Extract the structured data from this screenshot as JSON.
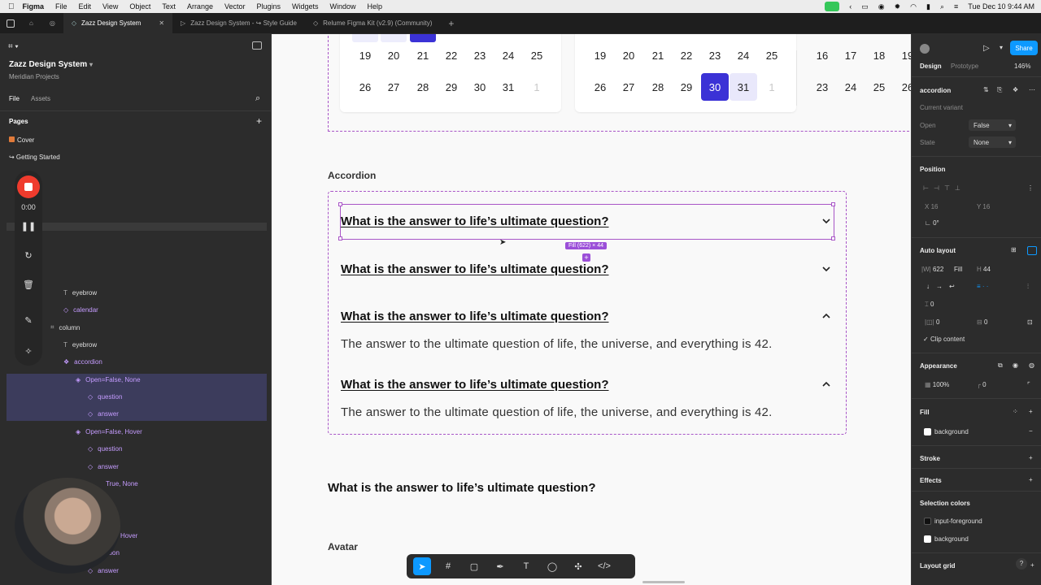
{
  "menubar": {
    "app": "Figma",
    "items": [
      "File",
      "Edit",
      "View",
      "Object",
      "Text",
      "Arrange",
      "Vector",
      "Plugins",
      "Widgets",
      "Window",
      "Help"
    ],
    "datetime": "Tue Dec 10  9:44 AM"
  },
  "tabs": [
    {
      "label": "Zazz Design System",
      "active": true
    },
    {
      "label": "Zazz Design System - ↪ Style Guide",
      "active": false
    },
    {
      "label": "Relume Figma Kit (v2.9) (Community)",
      "active": false
    }
  ],
  "left": {
    "file_name": "Zazz Design System",
    "project": "Meridian Projects",
    "tab_file": "File",
    "tab_assets": "Assets",
    "pages_heading": "Pages",
    "pages": [
      "Cover",
      "↪ Getting Started"
    ],
    "layers": [
      {
        "label": "eyebrow",
        "kind": "text"
      },
      {
        "label": "calendar",
        "kind": "comp"
      },
      {
        "label": "column",
        "kind": "frame"
      },
      {
        "label": "eyebrow",
        "kind": "text"
      },
      {
        "label": "accordion",
        "kind": "comp"
      },
      {
        "label": "Open=False, None",
        "kind": "comp"
      },
      {
        "label": "question",
        "kind": "comp"
      },
      {
        "label": "answer",
        "kind": "comp"
      },
      {
        "label": "Open=False, Hover",
        "kind": "comp"
      },
      {
        "label": "question",
        "kind": "comp"
      },
      {
        "label": "answer",
        "kind": "comp"
      },
      {
        "label": "True, None",
        "kind": "comp"
      },
      {
        "label": "Hover",
        "kind": "comp"
      },
      {
        "label": "stion",
        "kind": "comp"
      },
      {
        "label": "answer",
        "kind": "comp"
      }
    ]
  },
  "recorder": {
    "time": "0:00"
  },
  "canvas": {
    "calendar_rows_a": [
      [
        "19",
        "20",
        "21",
        "22",
        "23",
        "24",
        "25"
      ],
      [
        "26",
        "27",
        "28",
        "29",
        "30",
        "31",
        "1"
      ]
    ],
    "calendar_rows_b": [
      [
        "19",
        "20",
        "21",
        "22",
        "23",
        "24",
        "25"
      ],
      [
        "26",
        "27",
        "28",
        "29",
        "30",
        "31",
        "1"
      ]
    ],
    "calendar_rows_c": [
      [
        "16",
        "17",
        "18",
        "19"
      ],
      [
        "23",
        "24",
        "25",
        "26"
      ]
    ],
    "accordion_title": "Accordion",
    "question": "What is the answer to life’s ultimate question?",
    "answer": "The answer to the ultimate question of life, the universe, and everything is 42.",
    "fill_tag": "Fill (622) × 44",
    "standalone_question": "What is the answer to life’s ultimate question?",
    "avatar_title": "Avatar"
  },
  "right": {
    "tab_design": "Design",
    "tab_prototype": "Prototype",
    "zoom": "146%",
    "share": "Share",
    "component_name": "accordion",
    "current_variant": "Current variant",
    "prop_open_label": "Open",
    "prop_open_value": "False",
    "prop_state_label": "State",
    "prop_state_value": "None",
    "position": "Position",
    "x_value": "16",
    "y_value": "16",
    "rotation": "0°",
    "auto_layout": "Auto layout",
    "w_value": "622",
    "w_mode": "Fill",
    "h_value": "44",
    "gap_value": "0",
    "pad_h": "0",
    "pad_v": "0",
    "clip_content": "Clip content",
    "appearance": "Appearance",
    "opacity": "100%",
    "radius": "0",
    "fill": "Fill",
    "fill_style": "background",
    "stroke": "Stroke",
    "effects": "Effects",
    "selection_colors": "Selection colors",
    "sel_color_1": "input-foreground",
    "sel_color_2": "background",
    "layout_grid": "Layout grid"
  },
  "colors": {
    "accent": "#3b32d6",
    "selection": "#a855c7",
    "figma_blue": "#0d99ff",
    "recorder_red": "#ef3b2d"
  }
}
